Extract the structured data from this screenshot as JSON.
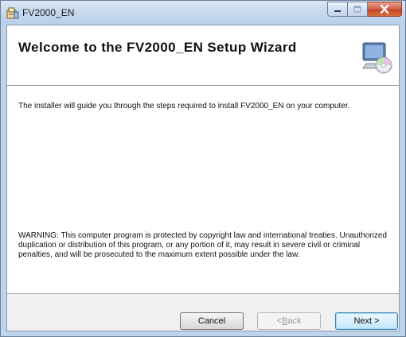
{
  "window": {
    "title": "FV2000_EN",
    "buttons": {
      "minimize": "minimize",
      "maximize": "maximize",
      "close": "close"
    }
  },
  "banner": {
    "title": "Welcome to the FV2000_EN Setup Wizard",
    "icon": "computer-cd-icon"
  },
  "content": {
    "intro": "The installer will guide you through the steps required to install FV2000_EN on your computer.",
    "warning": "WARNING: This computer program is protected by copyright law and international treaties. Unauthorized duplication or distribution of this program, or any portion of it, may result in severe civil or criminal penalties, and will be prosecuted to the maximum extent possible under the law."
  },
  "footer": {
    "cancel_label": "Cancel",
    "back_prefix": "< ",
    "back_accel": "B",
    "back_rest": "ack",
    "next_label": "Next >"
  },
  "colors": {
    "close_button": "#c4452b",
    "title_bar": "#c6d8ee",
    "default_button_border": "#3c7fb1"
  }
}
